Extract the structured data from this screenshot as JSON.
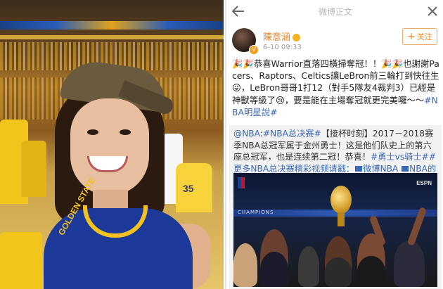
{
  "header": {
    "title": "微博正文"
  },
  "post": {
    "author": "陳意涵",
    "time": "6-10 09:33",
    "follow_label": "关注",
    "text": "🎉🎉恭喜Warrior直落四橫掃奪冠！！🎉🎉也謝謝Pacers、Raptors、Celtics讓LeBron前三輪打到快往生😜，LeBron哥哥1打12（對手5隊友4裁判3）已經是神獸等級了😢，要是能在主場奪冠就更完美囉～～",
    "hashtag": "#NBA明星說#"
  },
  "repost": {
    "mention": "@NBA",
    "text_part1": ":",
    "tag1": "#NBA总决赛#",
    "text_part2": "【接杯时刻】2017－2018赛季NBA总冠军属于金州勇士！这是他们队史上的第六座总冠军，也是连续第二冠！恭喜！",
    "tag2": "#勇士vs骑士#",
    "tag3": "#更多NBA总决赛精彩视频请戳：",
    "link1": "微博NBA",
    "link2": "NBA的微博视频"
  },
  "media": {
    "banner_text": "CHAMPIONS",
    "network": "ESPN"
  },
  "photo": {
    "jersey_text": "GOLDEN STATE",
    "fan_number": "35"
  },
  "colors": {
    "author": "#e8822a",
    "link": "#3a6ab5",
    "follow": "#f08a2a"
  },
  "icons": {
    "back": "arrow-left-icon",
    "close": "close-icon",
    "verified": "verified-badge-icon",
    "video": "video-icon"
  }
}
